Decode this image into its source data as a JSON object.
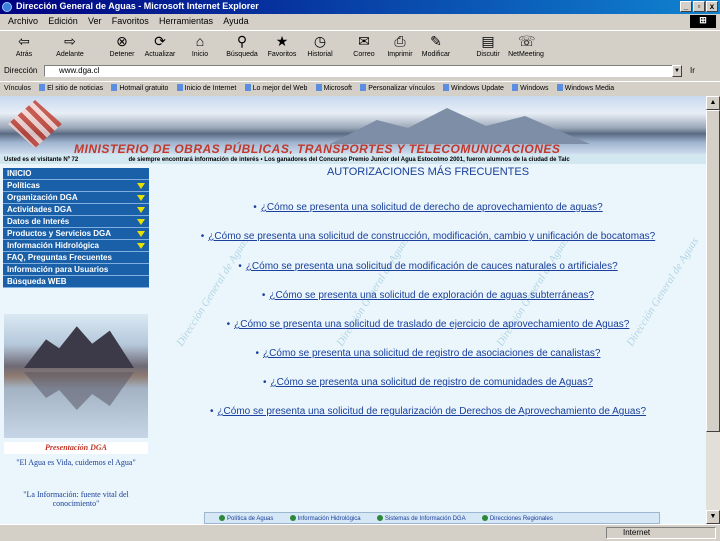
{
  "window": {
    "title": "Dirección General de Aguas - Microsoft Internet Explorer",
    "buttons": [
      "_",
      "▫",
      "x"
    ]
  },
  "menubar": {
    "items": [
      "Archivo",
      "Edición",
      "Ver",
      "Favoritos",
      "Herramientas",
      "Ayuda"
    ]
  },
  "toolbar": {
    "buttons": [
      {
        "label": "Atrás",
        "icon": "back-arrow-icon",
        "glyph": "⇦"
      },
      {
        "label": "Adelante",
        "icon": "forward-arrow-icon",
        "glyph": "⇨"
      },
      {
        "label": "Detener",
        "icon": "stop-icon",
        "glyph": "⊗"
      },
      {
        "label": "Actualizar",
        "icon": "refresh-icon",
        "glyph": "⟳"
      },
      {
        "label": "Inicio",
        "icon": "home-icon",
        "glyph": "⌂"
      },
      {
        "label": "Búsqueda",
        "icon": "search-icon",
        "glyph": "⚲"
      },
      {
        "label": "Favoritos",
        "icon": "favorites-icon",
        "glyph": "★"
      },
      {
        "label": "Historial",
        "icon": "history-icon",
        "glyph": "◷"
      },
      {
        "label": "Correo",
        "icon": "mail-icon",
        "glyph": "✉"
      },
      {
        "label": "Imprimir",
        "icon": "print-icon",
        "glyph": "⎙"
      },
      {
        "label": "Modificar",
        "icon": "edit-icon",
        "glyph": "✎"
      },
      {
        "label": "Discutir",
        "icon": "discuss-icon",
        "glyph": "▤"
      },
      {
        "label": "NetMeeting",
        "icon": "netmeeting-icon",
        "glyph": "☏"
      }
    ]
  },
  "address": {
    "label": "Dirección",
    "value": "www.dga.cl",
    "go": "Ir"
  },
  "links": {
    "label": "Vínculos",
    "items": [
      "El sitio de noticias",
      "Hotmail gratuito",
      "Inicio de Internet",
      "Lo mejor del Web",
      "Microsoft",
      "Personalizar vínculos",
      "Windows Update",
      "Windows",
      "Windows Media"
    ]
  },
  "page": {
    "banner_title": "MINISTERIO DE OBRAS PÚBLICAS, TRANSPORTES Y TELECOMUNICACIONES",
    "visits": "Usted es el visitante Nº 72",
    "ticker": "de siempre encontrará información de interés   •   Los ganadores del Concurso Premio Junior del Agua Estocolmo 2001, fueron alumnos de la ciudad de Talc",
    "menu": [
      {
        "label": "INICIO",
        "arrow": false
      },
      {
        "label": "Políticas",
        "arrow": true
      },
      {
        "label": "Organización DGA",
        "arrow": true
      },
      {
        "label": "Actividades DGA",
        "arrow": true
      },
      {
        "label": "Datos de Interés",
        "arrow": true
      },
      {
        "label": "Productos y Servicios DGA",
        "arrow": true
      },
      {
        "label": "Información Hidrológica",
        "arrow": true
      },
      {
        "label": "FAQ, Preguntas Frecuentes",
        "arrow": false
      },
      {
        "label": "Información para Usuarios",
        "arrow": false
      },
      {
        "label": "Búsqueda WEB",
        "arrow": false
      }
    ],
    "presentation": "Presentación DGA",
    "quote1": "\"El Agua es Vida, cuidemos el Agua\"",
    "quote2": "\"La Información: fuente vital del conocimiento\"",
    "section_title": "AUTORIZACIONES MÁS FRECUENTES",
    "faq": [
      {
        "bullet": "•",
        "text": "¿Cómo se presenta una solicitud de derecho de aprovechamiento de aguas?"
      },
      {
        "bullet": "•",
        "text": "¿Cómo se presenta una solicitud de construcción, modificación, cambio y unificación de bocatomas?"
      },
      {
        "bullet": "•",
        "text": "¿Cómo se presenta una solicitud de modificación de cauces naturales o artificiales?"
      },
      {
        "bullet": "•",
        "text": "¿Cómo se presenta una solicitud de exploración de aguas subterráneas?"
      },
      {
        "bullet": "•",
        "text": "¿Cómo se presenta una solicitud de traslado de ejercicio de aprovechamiento de Aguas?"
      },
      {
        "bullet": "•",
        "text": "¿Cómo se presenta una solicitud de registro de asociaciones de canalistas?"
      },
      {
        "bullet": "•",
        "text": "¿Cómo se presenta una solicitud de registro de comunidades de Aguas?"
      },
      {
        "bullet": "•",
        "text": "¿Cómo se presenta una solicitud de regularización de Derechos de Aprovechamiento de Aguas?"
      }
    ],
    "watermark": "Dirección General de Aguas",
    "bottom_tabs": [
      "Política de Aguas",
      "Información Hidrológica",
      "Sistemas de Información DGA",
      "Direcciones Regionales"
    ]
  },
  "status": {
    "text": "",
    "zone": "Internet"
  },
  "colors": {
    "menu_bg": "#1a60a8",
    "menu_arrow": "#e8e000",
    "link": "#1a3f9c",
    "accent_red": "#c0392b",
    "page_bg": "#eaf6fb"
  }
}
